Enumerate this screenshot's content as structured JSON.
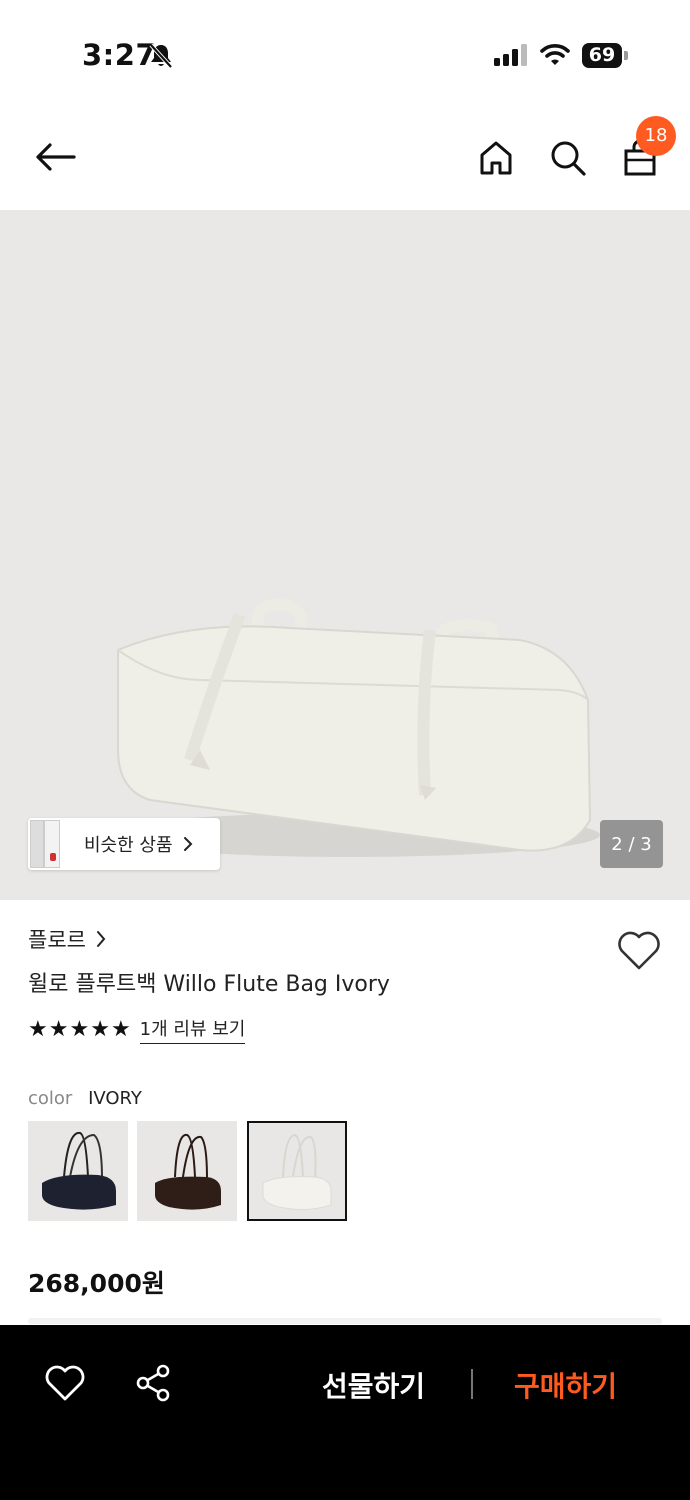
{
  "status_bar": {
    "time": "3:27",
    "battery": "69",
    "icons": [
      "bell-slash-icon",
      "signal-icon",
      "wifi-icon",
      "battery-icon"
    ]
  },
  "nav": {
    "icons": [
      "back-arrow-icon",
      "home-icon",
      "search-icon",
      "shopping-bag-icon"
    ],
    "cart_count": "18"
  },
  "gallery": {
    "similar_label": "비슷한 상품",
    "page_counter": "2 / 3"
  },
  "product": {
    "brand": "플로르",
    "name": "윌로 플루트백 Willo Flute Bag Ivory",
    "rating_stars": 5,
    "review_link": "1개 리뷰 보기",
    "color_label": "color",
    "color_value": "IVORY",
    "swatches": [
      "NAVY",
      "BROWN",
      "IVORY"
    ],
    "price": "268,000원"
  },
  "bottom_bar": {
    "gift_label": "선물하기",
    "buy_label": "구매하기"
  },
  "colors": {
    "accent": "#ff5a1f",
    "image_bg": "#e9e8e6",
    "bottom_bar_bg": "#000000"
  }
}
